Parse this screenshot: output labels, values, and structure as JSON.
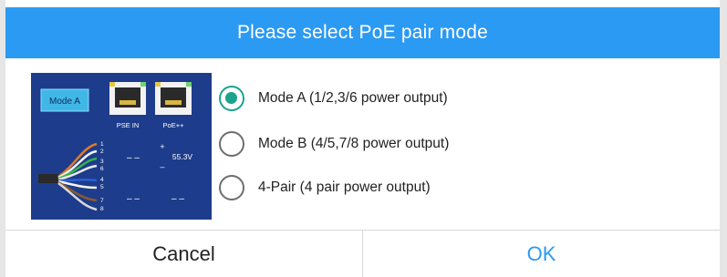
{
  "dialog": {
    "title": "Please select PoE pair mode",
    "diagram": {
      "mode_badge": "Mode A",
      "port_left_label": "PSE IN",
      "port_right_label": "PoE++",
      "pin_numbers": [
        "1",
        "2",
        "3",
        "6",
        "4",
        "5",
        "7",
        "8"
      ],
      "dash_pair_1": "– –",
      "dash_pair_2": "– –",
      "dash_pair_3": "– –",
      "plus_sign": "+",
      "minus_sign": "–",
      "voltage": "55.3V"
    },
    "options": [
      {
        "label": "Mode A (1/2,3/6 power output)",
        "selected": true
      },
      {
        "label": "Mode B (4/5,7/8 power output)",
        "selected": false
      },
      {
        "label": "4-Pair (4 pair power output)",
        "selected": false
      }
    ],
    "buttons": {
      "cancel": "Cancel",
      "ok": "OK"
    }
  },
  "colors": {
    "header": "#2b9af3",
    "accent_radio": "#1aa48e",
    "diagram_bg": "#1d3c8b",
    "badge": "#3fb8e8"
  }
}
